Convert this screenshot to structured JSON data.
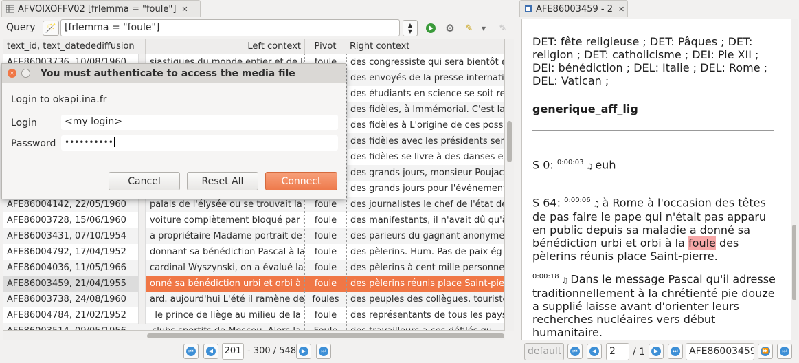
{
  "left_tab": {
    "title": "AFVOIXOFFV02 [frlemma = \"foule\"]"
  },
  "query": {
    "label": "Query",
    "value": "[frlemma = \"foule\"]"
  },
  "table": {
    "headers": [
      "text_id, text_datedediffusion",
      "Left context",
      "Pivot",
      "Right context"
    ],
    "rows": [
      {
        "id": "AFE86003736, 10/08/1960",
        "left": "siastiques du monde entier et de la",
        "pivot": "foule",
        "right": "des congressiste qui sera bientôt e"
      },
      {
        "id": "",
        "left": "",
        "pivot": "",
        "right": "des envoyés de la presse internati"
      },
      {
        "id": "",
        "left": "",
        "pivot": "",
        "right": "des étudiants en science se soit re"
      },
      {
        "id": "",
        "left": "",
        "pivot": "",
        "right": "des fidèles, à Immémorial. C'est la"
      },
      {
        "id": "",
        "left": "",
        "pivot": "",
        "right": "des fidèles à L'origine de ces poss"
      },
      {
        "id": "",
        "left": "",
        "pivot": "",
        "right": "des fidèles avec les présidents ser"
      },
      {
        "id": "",
        "left": "",
        "pivot": "",
        "right": "des fidèles se livre à des danses e"
      },
      {
        "id": "",
        "left": "",
        "pivot": "",
        "right": "des grands jours, monsieur Poujac"
      },
      {
        "id": "",
        "left": "",
        "pivot": "",
        "right": "des grands jours pour l'événement"
      },
      {
        "id": "AFE86004142, 22/05/1960",
        "left": "palais de l'élysée ou se trouvait la",
        "pivot": "foule",
        "right": "des journalistes le chef de l'état dé"
      },
      {
        "id": "AFE86003728, 15/06/1960",
        "left": "voiture complètement bloqué par la",
        "pivot": "foule",
        "right": "des manifestants, il n'avait dû qu'à"
      },
      {
        "id": "AFE86003431, 07/10/1954",
        "left": "a propriétaire Madame portrait de la",
        "pivot": "foule",
        "right": "des parieurs du gagnant anonyme"
      },
      {
        "id": "AFE86004792, 17/04/1952",
        "left": "donnant sa bénédiction Pascal à la",
        "pivot": "foule",
        "right": "des pèlerins. Hum. Pas de paix ég"
      },
      {
        "id": "AFE86004036, 11/05/1966",
        "left": "cardinal Wyszynski, on a évalué la",
        "pivot": "foule",
        "right": "des pèlerins à cent mille personnes"
      },
      {
        "id": "AFE86003459, 21/04/1955",
        "left": "onné sa bénédiction urbi et orbi à la",
        "pivot": "foule",
        "right": "des pèlerins réunis place Saint-pier"
      },
      {
        "id": "AFE86003738, 24/08/1960",
        "left": "ard. aujourd'hui L'été il ramène des",
        "pivot": "foules",
        "right": "des peuples des collègues. touriste"
      },
      {
        "id": "AFE86004784, 21/02/1952",
        "left": "le prince de liège au milieu de la",
        "pivot": "foule",
        "right": "des représentants de tous les pays"
      },
      {
        "id": "AFE86003514, 09/05/1956",
        "left": "clubs sportifs de Moscou. Alors la",
        "pivot": "Foule",
        "right": "des travailleurs a ces défilés qu"
      }
    ]
  },
  "pagination": {
    "first": "201",
    "range": "- 300 / 548"
  },
  "dialog": {
    "title": "You must authenticate to access the media file",
    "subtitle": "Login to okapi.ina.fr",
    "login_label": "Login",
    "login_value": "<my login>",
    "password_label": "Password",
    "password_value": "••••••••••",
    "cancel": "Cancel",
    "reset": "Reset All",
    "connect": "Connect"
  },
  "right_tab": {
    "title": "AFE86003459 - 2"
  },
  "doc": {
    "p1": "DET: fête religieuse ; DET: Pâques ; DET: religion ; DET: catholicisme ; DEI: Pie XII ; DEI: bénédiction ; DEL: Italie ; DEL: Rome ; DEL: Vatican ;",
    "heading": "generique_aff_lig",
    "s0_label": "S 0:",
    "s0_time": "0:00:03",
    "s0_text": "euh",
    "s64_label": "S 64:",
    "s64_time": "0:00:06",
    "s64_text_before": "à Rome à l'occasion des têtes de pas faire le pape qui n'était pas apparu en public depuis sa maladie a donné sa bénédiction urbi et orbi à la",
    "s64_pivot": "foule",
    "s64_text_after": "des pèlerins réunis place Saint-pierre.",
    "p3_time": "0:00:18",
    "p3_text": "Dans le message Pascal qu'il adresse traditionnellement à la chrétienté pie douze a supplié laisse avant d'orienter leurs recherches nucléaires vers début humanitaire."
  },
  "right_nav": {
    "mode": "default",
    "page": "2",
    "total": "/ 1",
    "doc_id": "AFE86003459"
  },
  "colors": {
    "accent": "#f07746",
    "highlight": "#f7a8a8"
  }
}
